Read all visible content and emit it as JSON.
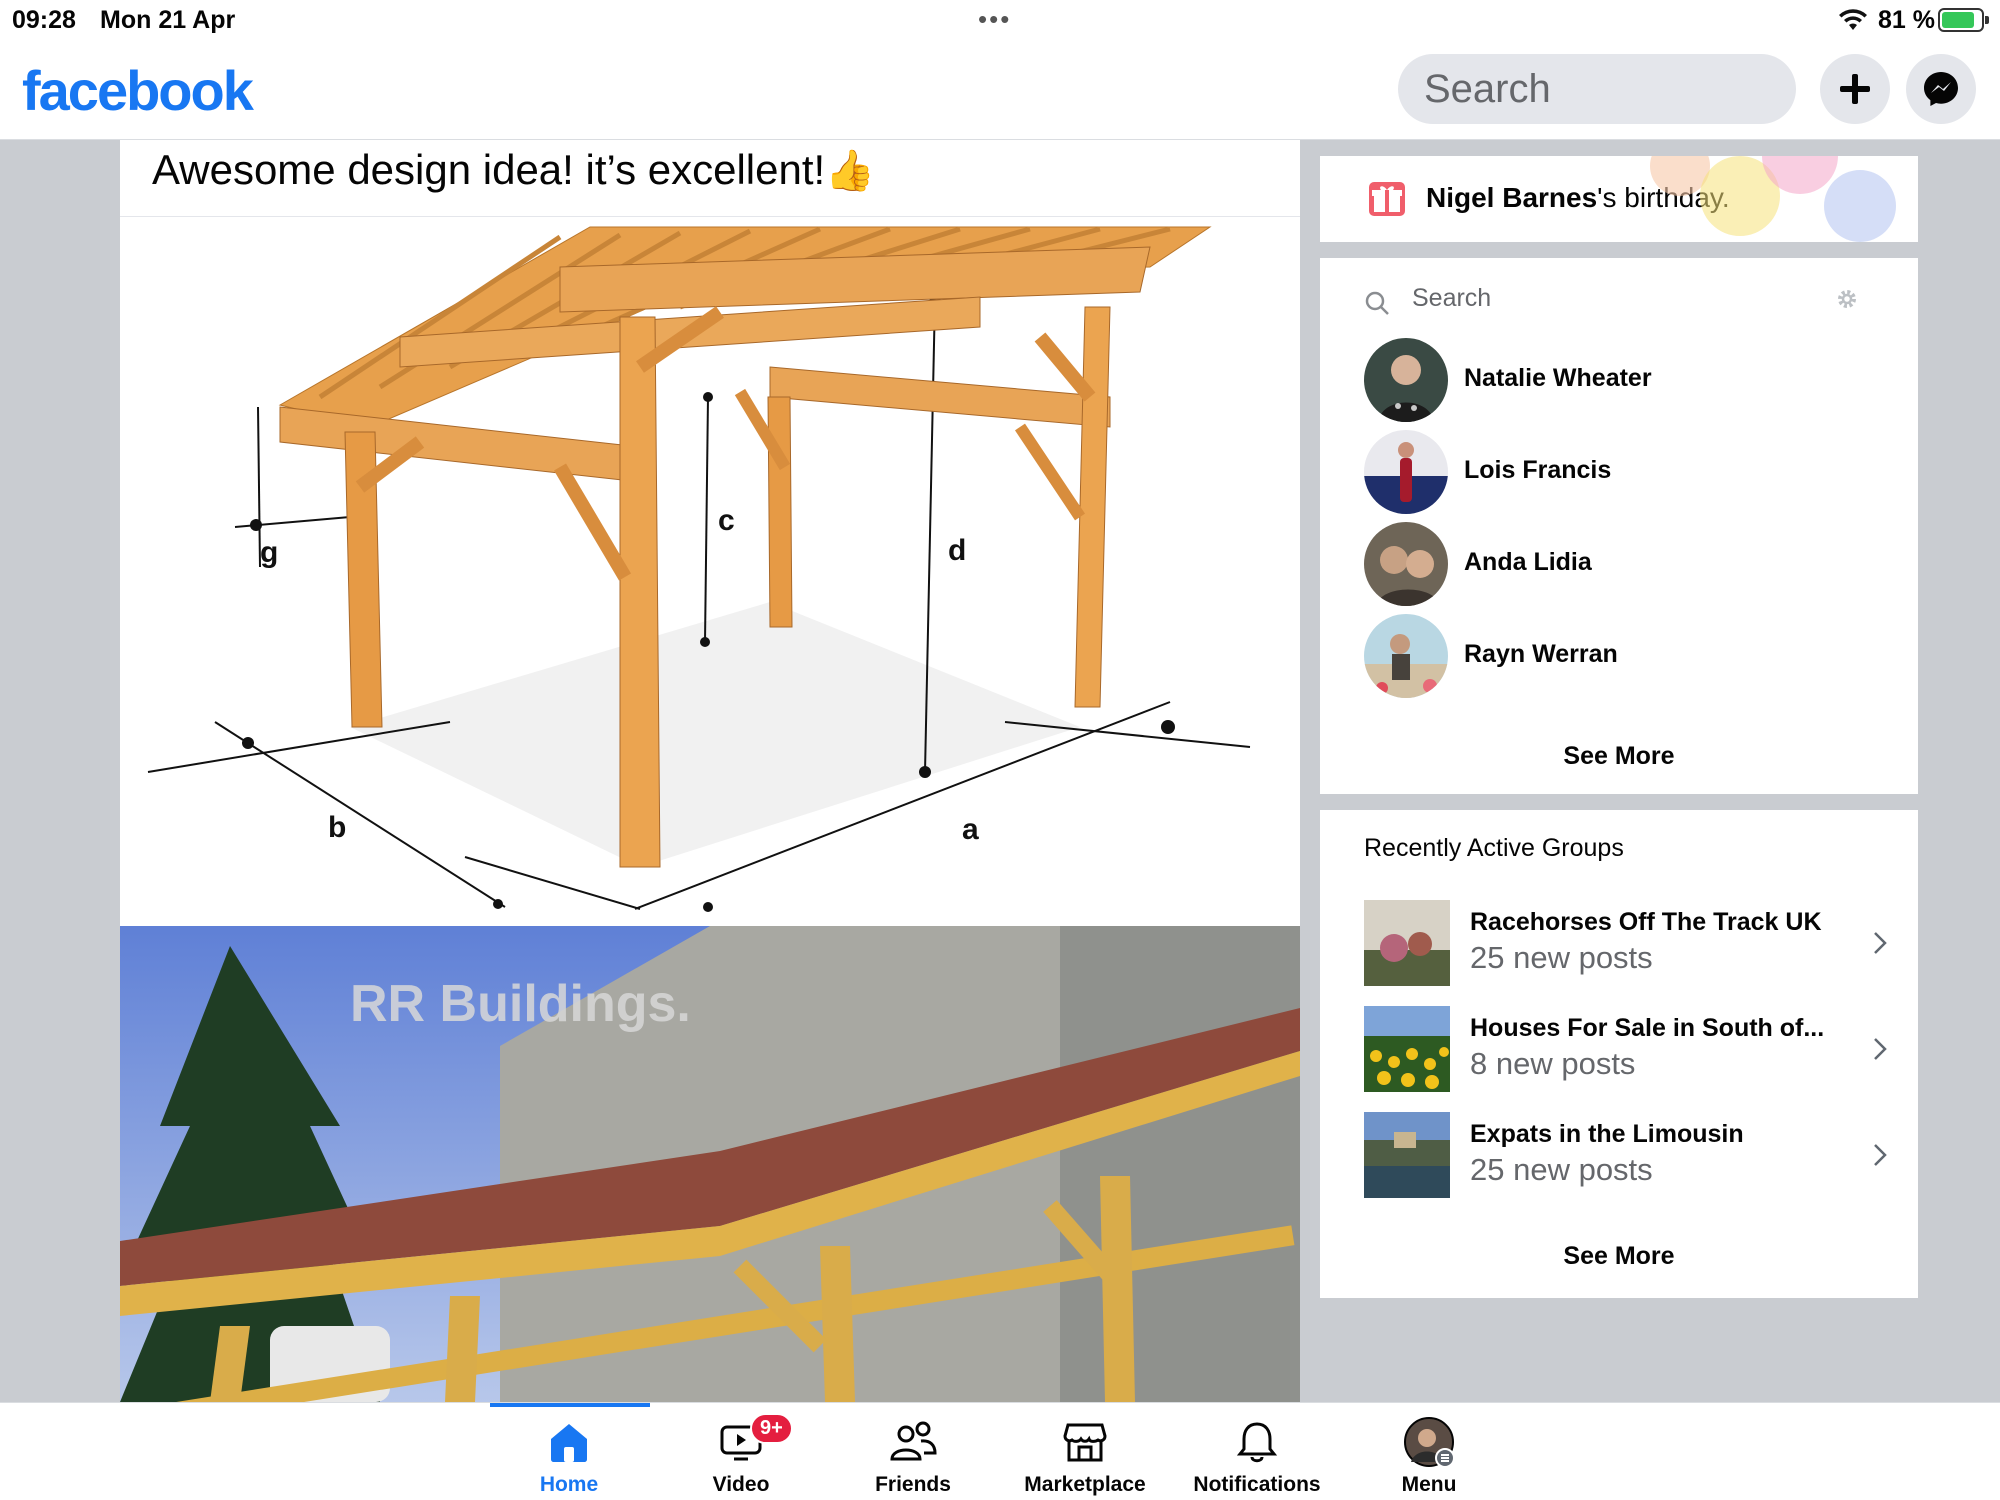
{
  "status_bar": {
    "time": "09:28",
    "date": "Mon 21 Apr",
    "battery_percent": "81 %",
    "battery_level": 0.81,
    "battery_color": "#35c759"
  },
  "header": {
    "logo": "facebook",
    "logo_color": "#1877f2",
    "search_placeholder": "Search",
    "icons": [
      "plus-icon",
      "messenger-icon"
    ]
  },
  "post": {
    "text": "Awesome design idea! it’s excellent!",
    "emoji": "👍",
    "diagram_labels": [
      "g",
      "c",
      "d",
      "b",
      "a"
    ],
    "photo_watermark": "RR Buildings."
  },
  "birthday": {
    "name": "Nigel Barnes",
    "suffix": "'s birthday."
  },
  "contacts": {
    "search_placeholder": "Search",
    "items": [
      {
        "name": "Natalie Wheater"
      },
      {
        "name": "Lois Francis"
      },
      {
        "name": "Anda Lidia"
      },
      {
        "name": "Rayn Werran"
      }
    ],
    "see_more": "See More"
  },
  "groups": {
    "title": "Recently Active Groups",
    "items": [
      {
        "name": "Racehorses Off The Track UK",
        "sub": "25 new posts"
      },
      {
        "name": "Houses For Sale in South of...",
        "sub": "8 new posts"
      },
      {
        "name": "Expats in the Limousin",
        "sub": "25 new posts"
      }
    ],
    "see_more": "See More"
  },
  "tabs": [
    {
      "label": "Home",
      "icon": "home-icon",
      "active": true
    },
    {
      "label": "Video",
      "icon": "video-icon",
      "badge": "9+"
    },
    {
      "label": "Friends",
      "icon": "friends-icon"
    },
    {
      "label": "Marketplace",
      "icon": "marketplace-icon"
    },
    {
      "label": "Notifications",
      "icon": "bell-icon"
    },
    {
      "label": "Menu",
      "icon": "menu-avatar-icon"
    }
  ]
}
